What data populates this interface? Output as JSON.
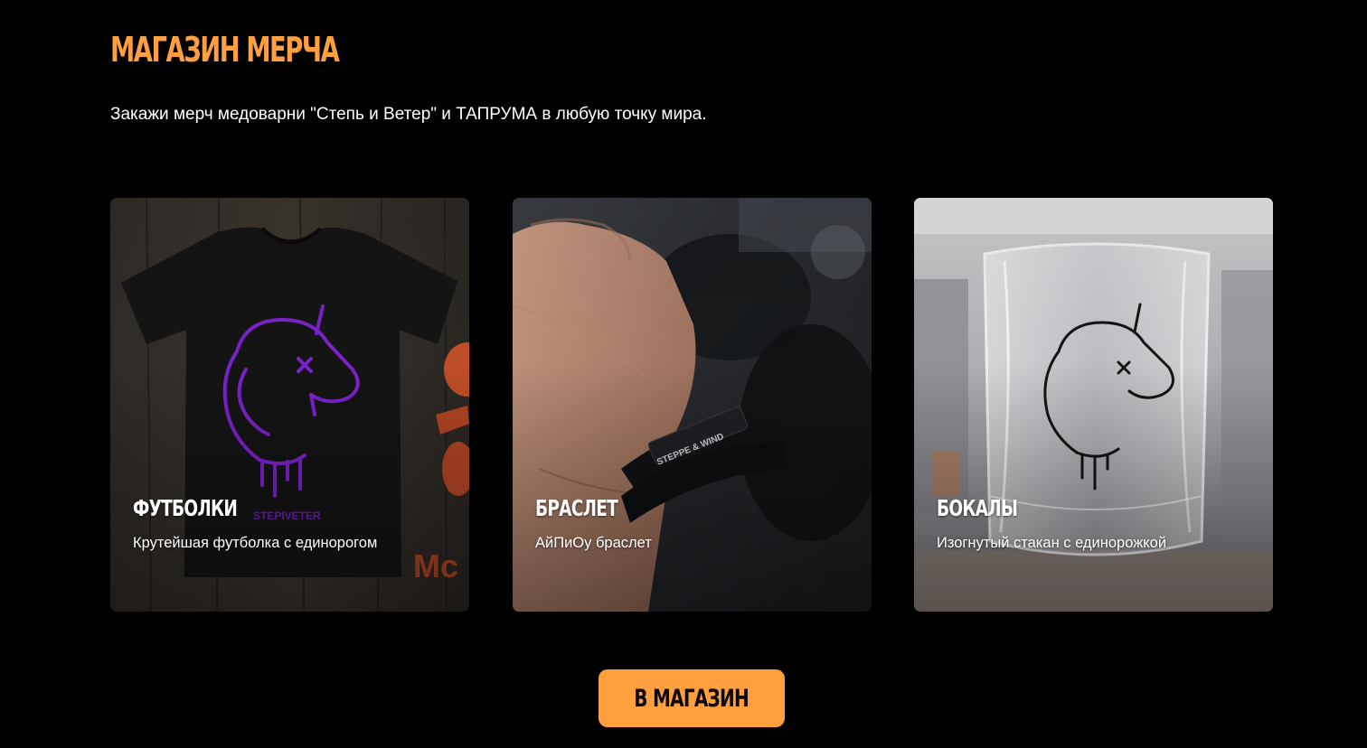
{
  "theme": {
    "background": "#000000",
    "accent": "#ff9f3f",
    "text": "#ffffff"
  },
  "section": {
    "title": "МАГАЗИН МЕРЧА",
    "lead": "Закажи мерч медоварни \"Степь и Ветер\" и ТАПРУМА в любую точку мира."
  },
  "cards": [
    {
      "title": "ФУТБОЛКИ",
      "description": "Крутейшая футболка с единорогом",
      "image": {
        "subject": "black-tshirt-purple-unicorn",
        "print_text": "STEPIVETER"
      }
    },
    {
      "title": "БРАСЛЕТ",
      "description": "АйПиОу браслет",
      "image": {
        "subject": "wrist-leather-bracelet",
        "print_text": "STEPPE & WIND"
      }
    },
    {
      "title": "БОКАЛЫ",
      "description": "Изогнутый стакан с единорожкой",
      "image": {
        "subject": "crumpled-glass-unicorn"
      }
    }
  ],
  "cta": {
    "label": "В МАГАЗИН"
  }
}
